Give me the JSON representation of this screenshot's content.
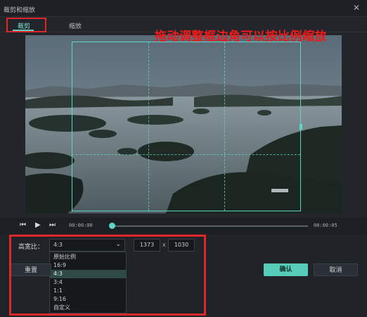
{
  "window": {
    "title": "裁剪和缩放",
    "close_glyph": "✕"
  },
  "tabs": [
    {
      "label": "裁剪",
      "active": true
    },
    {
      "label": "缩放",
      "active": false
    }
  ],
  "annotation": {
    "text": "拖动调整框边角可以按比例缩放",
    "color": "#f01818"
  },
  "player": {
    "prev_glyph": "⏮",
    "play_glyph": "▶",
    "next_glyph": "⏭",
    "time_start": "00:00:00",
    "time_end": "00:00:05",
    "progress": 0.0
  },
  "crop": {
    "ratio_label": "高宽比：",
    "ratio_value": "4:3",
    "chevron_glyph": "⌄",
    "width": "1373",
    "times_glyph": "x",
    "height": "1030",
    "options": [
      {
        "label": "原始比例",
        "selected": false
      },
      {
        "label": "16:9",
        "selected": false
      },
      {
        "label": "4:3",
        "selected": true
      },
      {
        "label": "3:4",
        "selected": false
      },
      {
        "label": "1:1",
        "selected": false
      },
      {
        "label": "9:16",
        "selected": false
      },
      {
        "label": "自定义",
        "selected": false
      }
    ]
  },
  "buttons": {
    "reset": "重置",
    "ok": "确认",
    "cancel": "取消"
  },
  "colors": {
    "accent": "#57cdb9",
    "highlight": "#e0262a"
  }
}
